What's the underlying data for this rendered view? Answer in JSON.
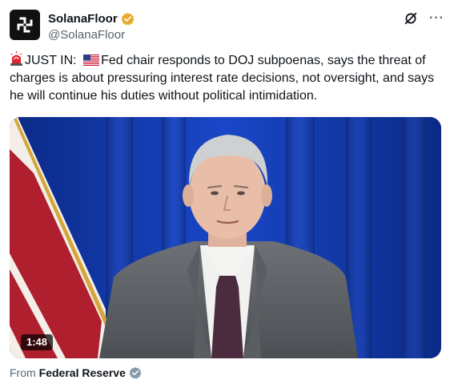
{
  "author": {
    "display_name": "SolanaFloor",
    "handle": "@SolanaFloor",
    "verified": true,
    "badge_color": "#e8a92c",
    "avatar_icon": "solanafloor-logo-icon"
  },
  "header_actions": {
    "grok_icon": "grok-slash-circle-icon",
    "more_label": "···"
  },
  "tweet": {
    "prefix": "JUST IN:",
    "siren_icon": "police-light-emoji",
    "flag_icon": "us-flag-emoji",
    "body": "Fed chair responds to DOJ subpoenas, says the threat of charges is about pressuring interest rate decisions, not oversight, and says he will continue his duties without political intimidation."
  },
  "media": {
    "kind": "video",
    "duration": "1:48",
    "subject": "man in grey suit in front of blue curtain and US flag"
  },
  "source": {
    "label": "From",
    "name": "Federal Reserve",
    "verified": true,
    "badge_color": "#829aab"
  }
}
